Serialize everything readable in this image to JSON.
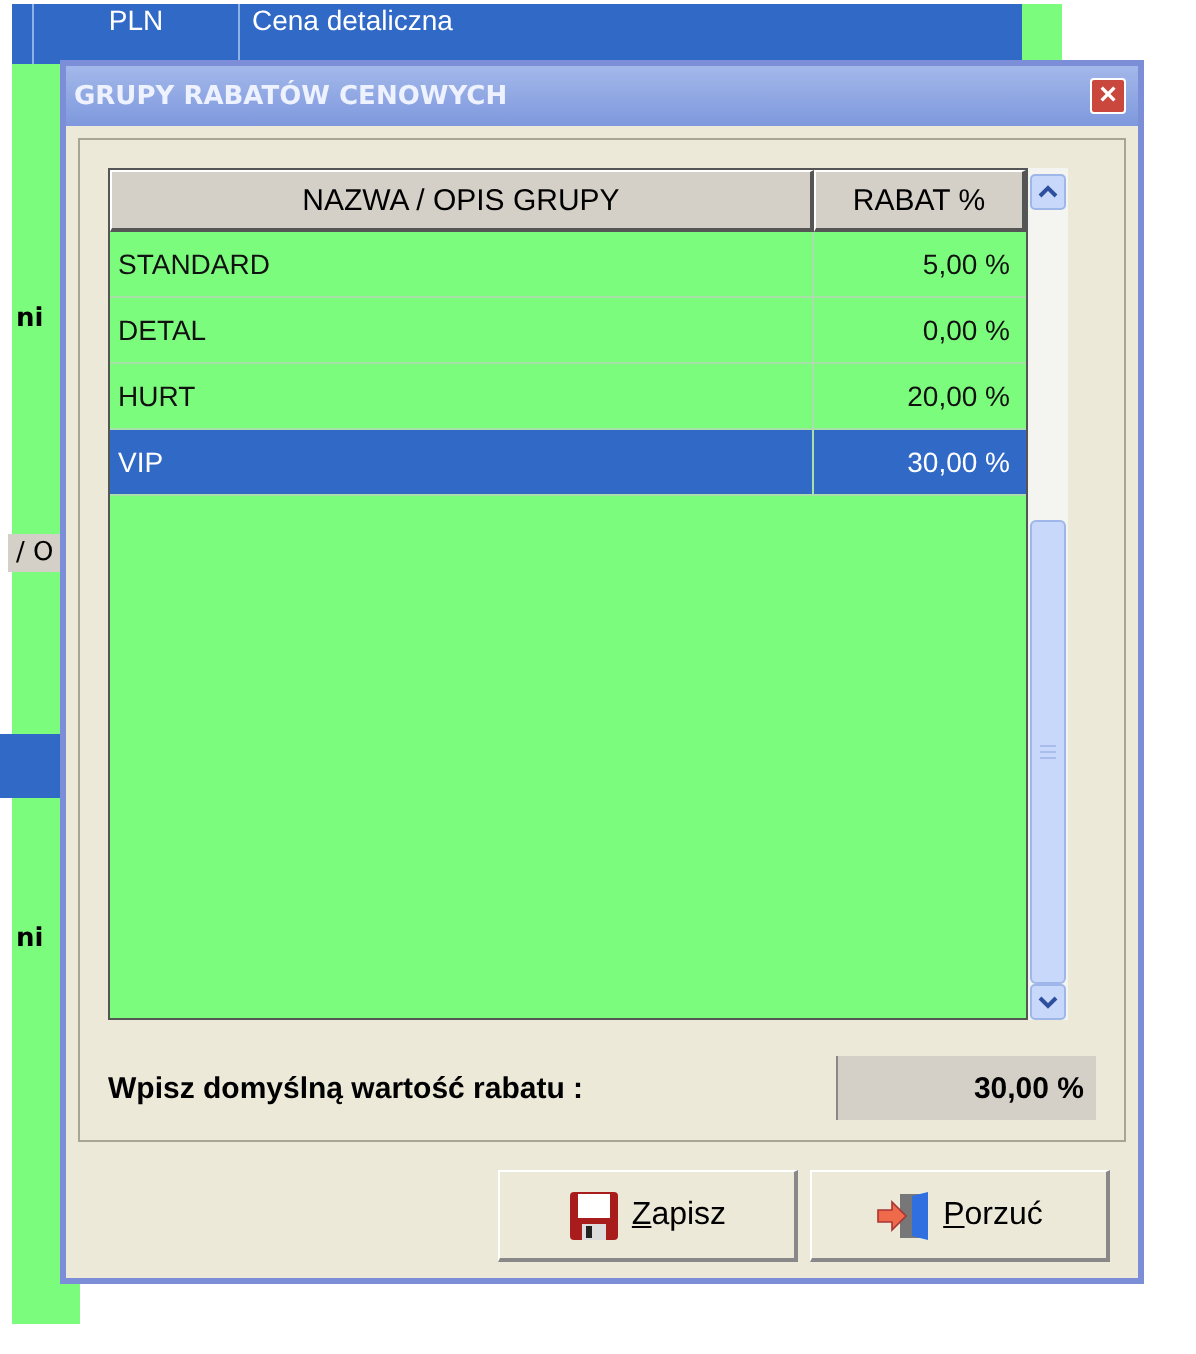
{
  "background_window": {
    "top_row": {
      "cells": [
        "PLN",
        "Cena detaliczna"
      ]
    },
    "left_fragments": [
      "ni",
      "/ O",
      "ni"
    ]
  },
  "dialog": {
    "title": "GRUPY RABATÓW CENOWYCH",
    "close": "×",
    "table": {
      "columns": [
        "NAZWA / OPIS GRUPY",
        "RABAT %"
      ],
      "rows": [
        {
          "name": "STANDARD",
          "discount": "5,00 %",
          "selected": false
        },
        {
          "name": "DETAL",
          "discount": "0,00 %",
          "selected": false
        },
        {
          "name": "HURT",
          "discount": "20,00 %",
          "selected": false
        },
        {
          "name": "VIP",
          "discount": "30,00 %",
          "selected": true
        }
      ]
    },
    "default_discount": {
      "label": "Wpisz domyślną wartość rabatu :",
      "value": "30,00 %"
    },
    "buttons": [
      {
        "kind": "save",
        "label": "Zapisz"
      },
      {
        "kind": "cancel",
        "label": "Porzuć"
      }
    ]
  }
}
